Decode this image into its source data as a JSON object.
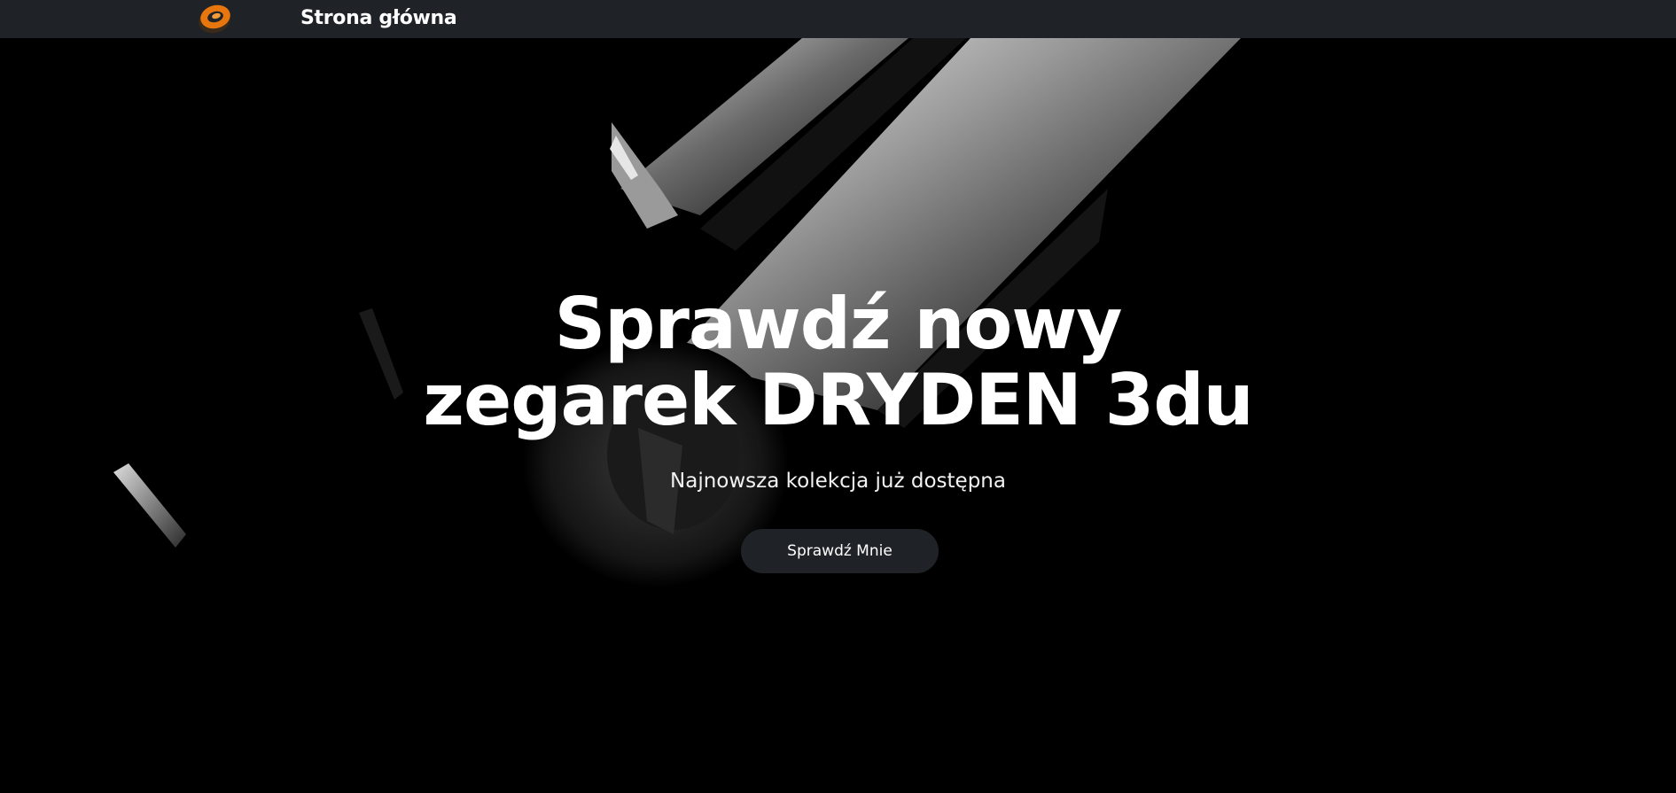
{
  "nav": {
    "logo_icon": "brand-logo-icon",
    "home_label": "Strona główna"
  },
  "hero": {
    "title_line1": "Sprawdź nowy",
    "title_line2": "zegarek DRYDEN 3du",
    "subtitle": "Najnowsza kolekcja już dostępna",
    "button_label": "Sprawdź Mnie",
    "background_image": "watch-closeup-image"
  },
  "colors": {
    "navbar_bg": "#1f2328",
    "page_bg": "#000000",
    "logo_accent": "#e8760f",
    "text": "#ffffff"
  }
}
